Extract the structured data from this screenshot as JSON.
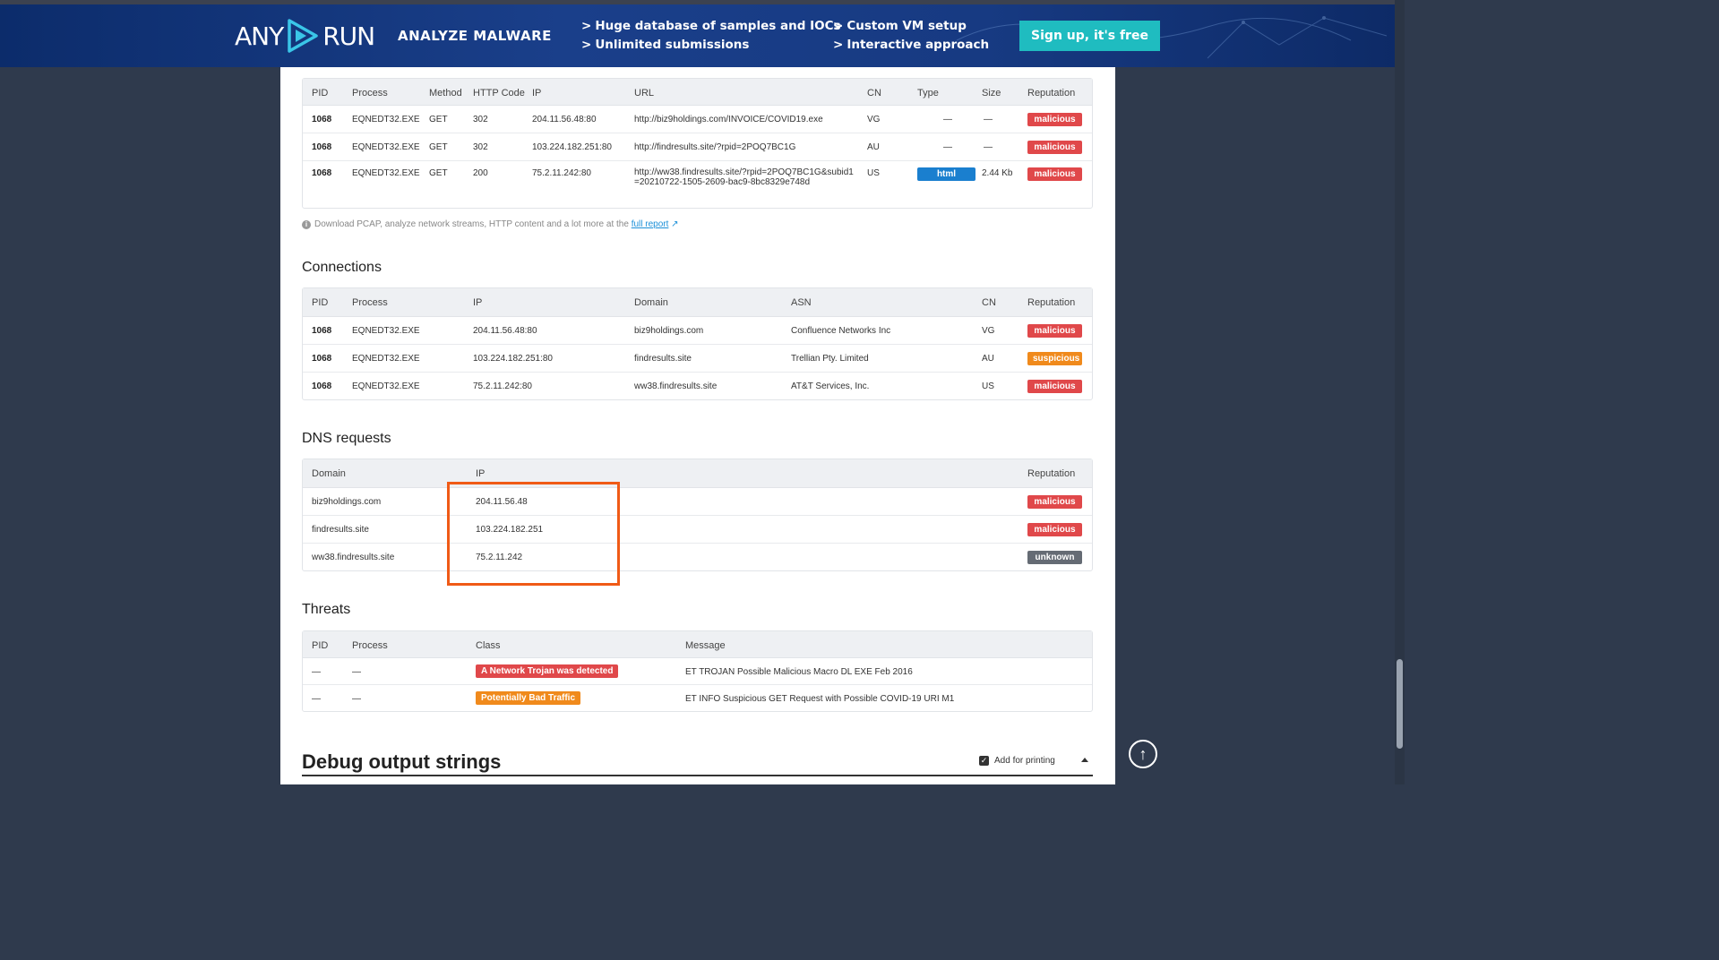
{
  "banner": {
    "logo_left": "ANY",
    "logo_right": "RUN",
    "tagline": "ANALYZE MALWARE",
    "features": [
      "Huge database of samples and IOCs",
      "Unlimited submissions",
      "Custom VM setup",
      "Interactive approach"
    ],
    "feature_arrow": ">",
    "signup_label": "Sign up, it's free"
  },
  "http": {
    "headers": [
      "PID",
      "Process",
      "Method",
      "HTTP Code",
      "IP",
      "URL",
      "CN",
      "Type",
      "Size",
      "Reputation"
    ],
    "rows": [
      {
        "pid": "1068",
        "process": "EQNEDT32.EXE",
        "method": "GET",
        "code": "302",
        "ip": "204.11.56.48:80",
        "url": "http://biz9holdings.com/INVOICE/COVID19.exe",
        "cn": "VG",
        "type": "—",
        "size": "—",
        "rep": "malicious"
      },
      {
        "pid": "1068",
        "process": "EQNEDT32.EXE",
        "method": "GET",
        "code": "302",
        "ip": "103.224.182.251:80",
        "url": "http://findresults.site/?rpid=2POQ7BC1G",
        "cn": "AU",
        "type": "—",
        "size": "—",
        "rep": "malicious"
      },
      {
        "pid": "1068",
        "process": "EQNEDT32.EXE",
        "method": "GET",
        "code": "200",
        "ip": "75.2.11.242:80",
        "url": "http://ww38.findresults.site/?rpid=2POQ7BC1G&subid1=20210722-1505-2609-bac9-8bc8329e748d",
        "cn": "US",
        "type": "html",
        "size": "2.44 Kb",
        "rep": "malicious"
      }
    ],
    "note": "Download PCAP, analyze network streams, HTTP content and a lot more at the",
    "note_link": "full report"
  },
  "connections": {
    "title": "Connections",
    "headers": [
      "PID",
      "Process",
      "IP",
      "Domain",
      "ASN",
      "CN",
      "Reputation"
    ],
    "rows": [
      {
        "pid": "1068",
        "process": "EQNEDT32.EXE",
        "ip": "204.11.56.48:80",
        "domain": "biz9holdings.com",
        "asn": "Confluence Networks Inc",
        "cn": "VG",
        "rep": "malicious"
      },
      {
        "pid": "1068",
        "process": "EQNEDT32.EXE",
        "ip": "103.224.182.251:80",
        "domain": "findresults.site",
        "asn": "Trellian Pty. Limited",
        "cn": "AU",
        "rep": "suspicious"
      },
      {
        "pid": "1068",
        "process": "EQNEDT32.EXE",
        "ip": "75.2.11.242:80",
        "domain": "ww38.findresults.site",
        "asn": "AT&T Services, Inc.",
        "cn": "US",
        "rep": "malicious"
      }
    ]
  },
  "dns": {
    "title": "DNS requests",
    "headers": [
      "Domain",
      "IP",
      "Reputation"
    ],
    "rows": [
      {
        "domain": "biz9holdings.com",
        "ip": "204.11.56.48",
        "rep": "malicious"
      },
      {
        "domain": "findresults.site",
        "ip": "103.224.182.251",
        "rep": "malicious"
      },
      {
        "domain": "ww38.findresults.site",
        "ip": "75.2.11.242",
        "rep": "unknown"
      }
    ]
  },
  "threats": {
    "title": "Threats",
    "headers": [
      "PID",
      "Process",
      "Class",
      "Message"
    ],
    "rows": [
      {
        "pid": "—",
        "process": "—",
        "class": "A Network Trojan was detected",
        "message": "ET TROJAN Possible Malicious Macro DL EXE Feb 2016"
      },
      {
        "pid": "—",
        "process": "—",
        "class": "Potentially Bad Traffic",
        "message": "ET INFO Suspicious GET Request with Possible COVID-19 URI M1"
      }
    ]
  },
  "debug": {
    "title": "Debug output strings",
    "print_label": "Add for printing"
  },
  "colors": {
    "malicious": "#e0484a",
    "suspicious": "#f08a1c",
    "unknown": "#656b74",
    "accent": "#1fbcc0",
    "highlight": "#f05a16"
  }
}
